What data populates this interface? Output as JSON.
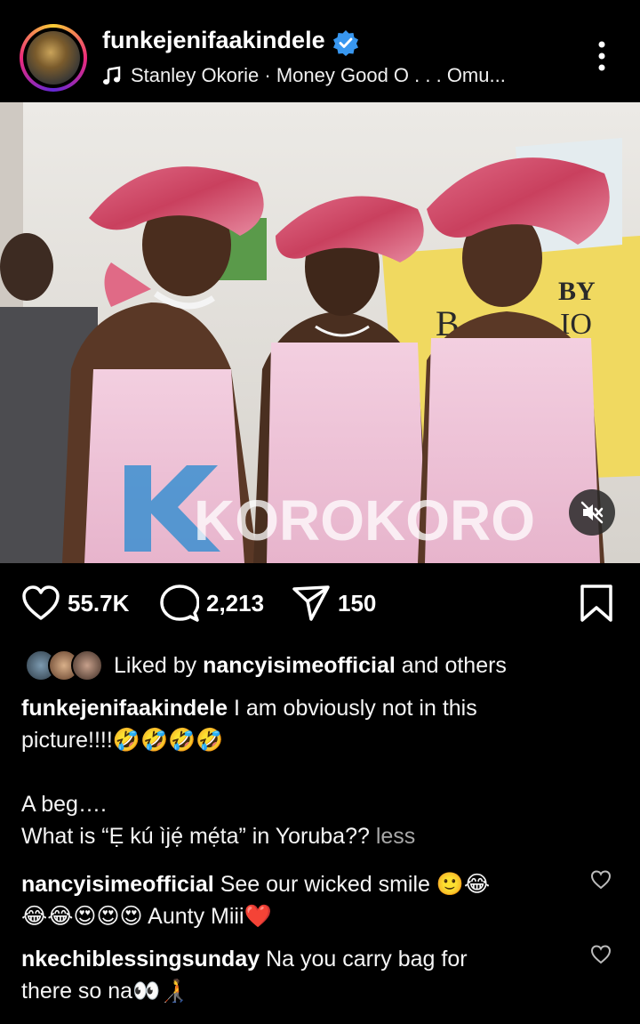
{
  "header": {
    "username": "funkejenifaakindele",
    "music": "Stanley Okorie · Money Good O . . . Omu..."
  },
  "media": {
    "watermark": "KOROKORO",
    "sign_text_1": "BY",
    "sign_text_2": "B-",
    "sign_text_3": "IO"
  },
  "actions": {
    "likes": "55.7K",
    "comments": "2,213",
    "shares": "150"
  },
  "liked_by": {
    "prefix": "Liked by",
    "user": "nancyisimeofficial",
    "suffix": "and others"
  },
  "caption": {
    "author": "funkejenifaakindele",
    "line1": "I am obviously not in this",
    "line2": "picture!!!!🤣🤣🤣🤣",
    "line3": "A beg….",
    "line4": "What is “Ẹ kú ìjẹ́ mẹ́ta” in Yoruba??",
    "less": "less"
  },
  "comments": [
    {
      "user": "nancyisimeofficial",
      "text": "See our wicked smile 🙂😂",
      "text2": "😂😂😍😍😍 Aunty Miii❤️"
    },
    {
      "user": "nkechiblessingsunday",
      "text": "Na you carry bag for",
      "text2": "there so na👀🧑‍🦯"
    }
  ],
  "colors": {
    "background": "#000000",
    "verified": "#3897f0",
    "watermark_k": "#3b8fd0"
  },
  "icons": [
    "verified-badge-icon",
    "music-note-icon",
    "more-options-icon",
    "mute-icon",
    "heart-icon",
    "comment-icon",
    "share-icon",
    "bookmark-icon"
  ]
}
